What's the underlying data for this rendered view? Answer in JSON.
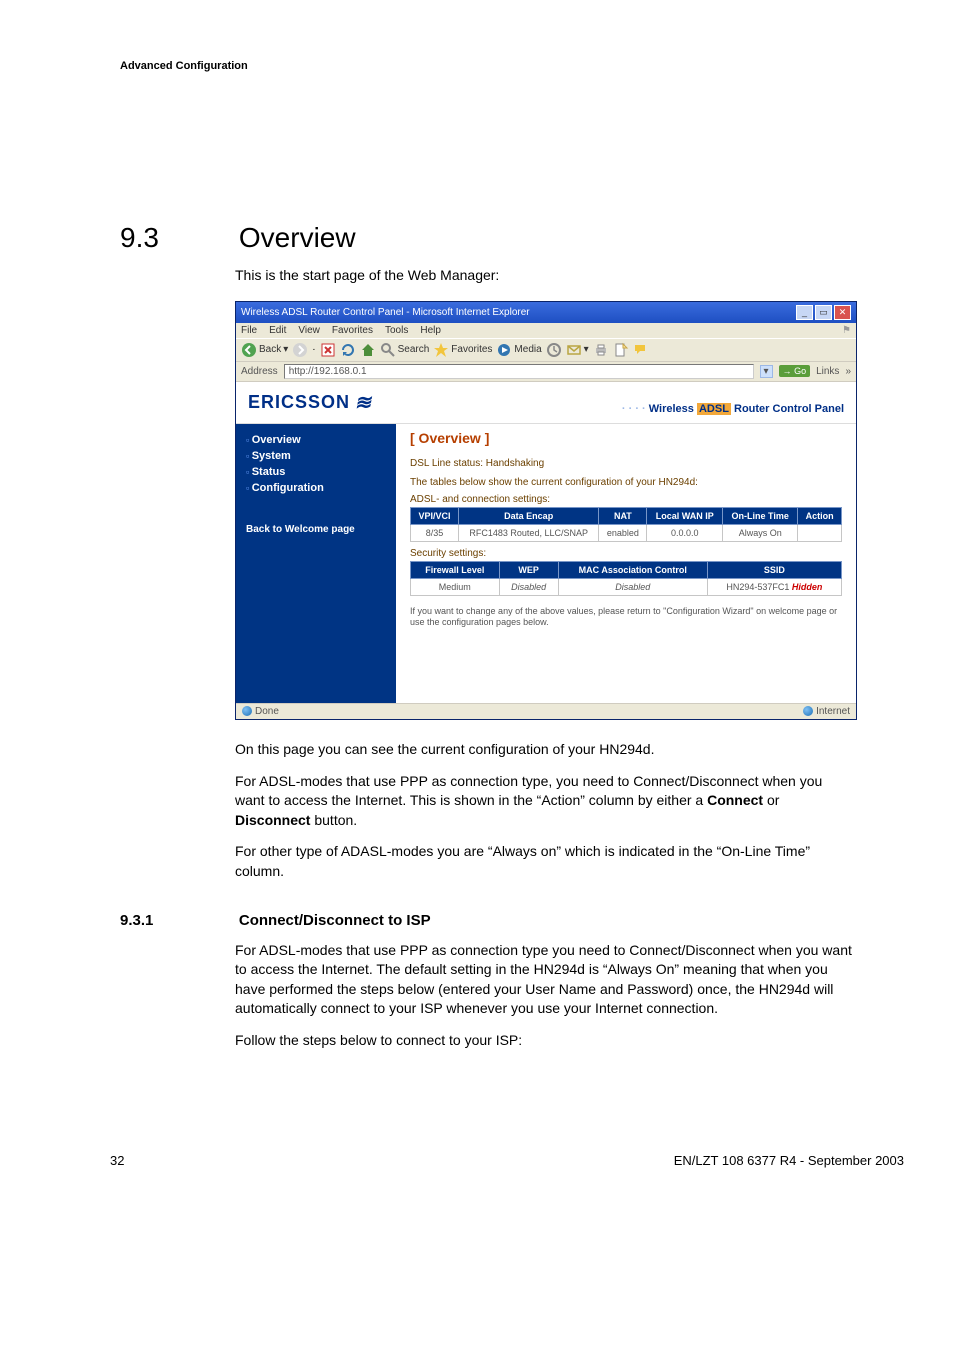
{
  "page": {
    "header": "Advanced Configuration",
    "section_num": "9.3",
    "section_title": "Overview",
    "intro": "This is the start page of the Web Manager:",
    "after1": "On this page you can see the current configuration of your HN294d.",
    "after2_pre": "For ADSL-modes that use PPP as connection type, you need to Connect/Disconnect when you want to access the Internet. This is shown in the “Action” column by either a ",
    "after2_bold1": "Connect",
    "after2_mid": " or ",
    "after2_bold2": "Disconnect",
    "after2_post": " button.",
    "after3": "For other type of ADASL-modes you are “Always on” which is indicated in the “On-Line Time” column.",
    "subsec_num": "9.3.1",
    "subsec_title": "Connect/Disconnect to ISP",
    "sub_para1": "For ADSL-modes that use PPP as connection type you need to Connect/Disconnect when you want to access the Internet. The default setting in the HN294d is “Always On” meaning that when you have performed the steps below (entered your User Name and Password) once, the HN294d will automatically connect to your ISP whenever you use your Internet connection.",
    "sub_para2": "Follow the steps below to connect to your ISP:",
    "footer_left": "32",
    "footer_right": "EN/LZT 108 6377 R4 - September 2003"
  },
  "browser": {
    "window_title": "Wireless ADSL Router Control Panel - Microsoft Internet Explorer",
    "menubar": [
      "File",
      "Edit",
      "View",
      "Favorites",
      "Tools",
      "Help"
    ],
    "toolbar": {
      "back": "Back",
      "search": "Search",
      "favorites": "Favorites",
      "media": "Media"
    },
    "address_label": "Address",
    "address_url": "http://192.168.0.1",
    "go_label": "Go",
    "links_label": "Links",
    "status_left": "Done",
    "status_right": "Internet"
  },
  "router": {
    "brand": "ERICSSON",
    "panel_title_pre": "Wireless ",
    "panel_title_adsl": "ADSL",
    "panel_title_post": " Router Control Panel",
    "nav": [
      "Overview",
      "System",
      "Status",
      "Configuration"
    ],
    "nav_back": "Back to Welcome page",
    "content": {
      "heading": "[ Overview ]",
      "dsl_label": "DSL Line status:",
      "dsl_value": "Handshaking",
      "tables_caption": "The tables below show the current configuration of your HN294d:",
      "adsl_caption": "ADSL- and connection settings:",
      "adsl_headers": [
        "VPI/VCI",
        "Data Encap",
        "NAT",
        "Local WAN IP",
        "On-Line Time",
        "Action"
      ],
      "adsl_row": [
        "8/35",
        "RFC1483 Routed, LLC/SNAP",
        "enabled",
        "0.0.0.0",
        "Always On",
        ""
      ],
      "sec_caption": "Security settings:",
      "sec_headers": [
        "Firewall Level",
        "WEP",
        "MAC Association Control",
        "SSID"
      ],
      "sec_row": [
        "Medium",
        "Disabled",
        "Disabled",
        "HN294-537FC1 Hidden"
      ],
      "config_note": "If you want to change any of the above values, please return to \"Configuration Wizard\" on welcome page or use the configuration pages below."
    }
  }
}
